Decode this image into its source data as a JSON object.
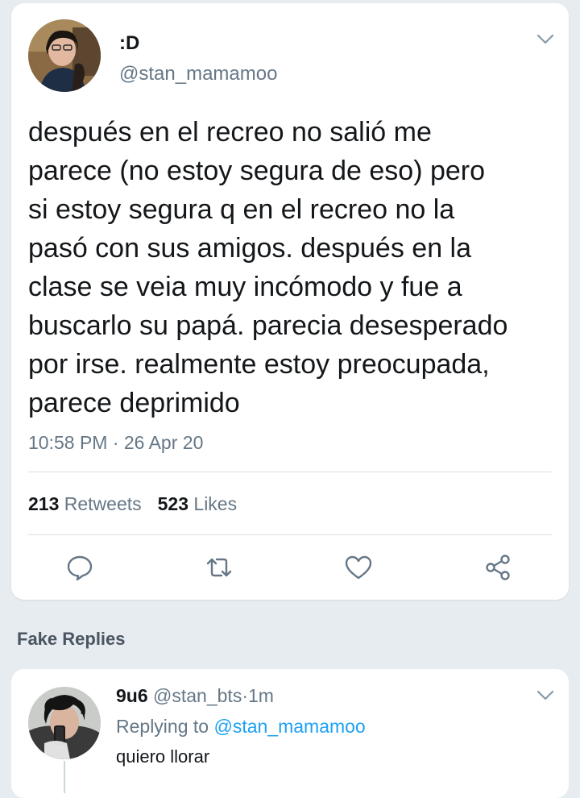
{
  "tweet": {
    "display_name": ":D",
    "handle": "@stan_mamamoo",
    "text": "después en el recreo no salió me\nparece (no estoy segura de eso) pero\nsi estoy segura q en el recreo no la\npasó con sus amigos. después en la\nclase se veia muy incómodo y fue a\nbuscarlo su papá. parecia desesperado\npor irse. realmente estoy preocupada,\nparece deprimido",
    "timestamp": "10:58 PM · 26 Apr 20",
    "retweets_count": "213",
    "retweets_label": "Retweets",
    "likes_count": "523",
    "likes_label": "Likes",
    "icons": {
      "menu": "chevron-down-icon",
      "reply": "reply-icon",
      "retweet": "retweet-icon",
      "like": "heart-icon",
      "share": "share-icon"
    }
  },
  "section_label": "Fake Replies",
  "reply": {
    "display_name": "9u6",
    "handle": "@stan_bts",
    "separator": "·",
    "time": "1m",
    "replying_prefix": "Replying to",
    "replying_mention": "@stan_mamamoo",
    "text": "quiero llorar"
  },
  "colors": {
    "background": "#e6ecf0",
    "card": "#ffffff",
    "primary_text": "#14171a",
    "secondary_text": "#657786",
    "accent": "#1da1f2"
  }
}
